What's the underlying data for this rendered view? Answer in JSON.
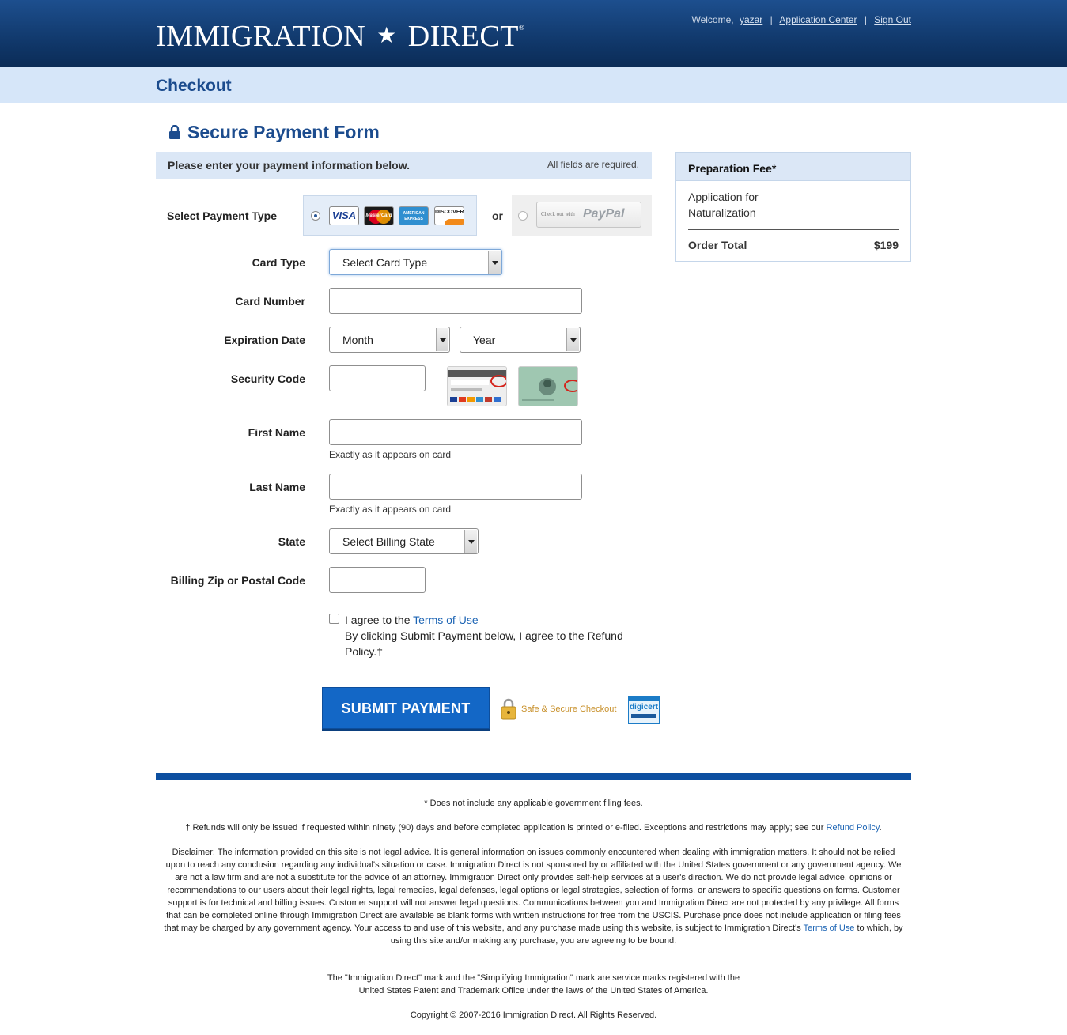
{
  "header": {
    "logo_left": "IMMIGRATION",
    "logo_star": "★",
    "logo_right": "DIRECT",
    "logo_reg": "®",
    "welcome": "Welcome,",
    "username": "yazar",
    "nav_sep": "|",
    "application_center": "Application Center",
    "sign_out": "Sign Out"
  },
  "page": {
    "title": "Checkout"
  },
  "form": {
    "heading": "Secure Payment Form",
    "intro": "Please enter your payment information below.",
    "required_note": "All fields are required.",
    "payment_type_label": "Select Payment Type",
    "cards": {
      "visa": "VISA",
      "mastercard": "MasterCard",
      "amex": "AMERICAN EXPRESS",
      "discover": "DISCOVER"
    },
    "or": "or",
    "paypal_small": "Check out with",
    "paypal_brand": "PayPal",
    "card_type_label": "Card Type",
    "card_type_value": "Select Card Type",
    "card_number_label": "Card Number",
    "expiration_label": "Expiration Date",
    "month_value": "Month",
    "year_value": "Year",
    "security_code_label": "Security Code",
    "first_name_label": "First Name",
    "first_name_hint": "Exactly as it appears on card",
    "last_name_label": "Last Name",
    "last_name_hint": "Exactly as it appears on card",
    "state_label": "State",
    "state_value": "Select Billing State",
    "zip_label": "Billing Zip or Postal Code",
    "agree_prefix": "I agree to the ",
    "terms_link": "Terms of Use",
    "agree_body": "By clicking Submit Payment below, I agree to the Refund Policy.†",
    "submit": "SUBMIT PAYMENT",
    "secure_checkout": "Safe & Secure Checkout"
  },
  "summary": {
    "heading": "Preparation Fee*",
    "item": "Application for Naturalization",
    "total_label": "Order Total",
    "total_value": "$199"
  },
  "footer": {
    "note1": "* Does not include any applicable government filing fees.",
    "refund_text": "† Refunds will only be issued if requested within ninety (90) days and before completed application is printed or e-filed. Exceptions and restrictions may apply; see our ",
    "refund_link": "Refund Policy",
    "refund_end": ".",
    "disclaimer": "Disclaimer: The information provided on this site is not legal advice. It is general information on issues commonly encountered when dealing with immigration matters. It should not be relied upon to reach any conclusion regarding any individual's situation or case. Immigration Direct is not sponsored by or affiliated with the United States government or any government agency. We are not a law firm and are not a substitute for the advice of an attorney. Immigration Direct only provides self-help services at a user's direction. We do not provide legal advice, opinions or recommendations to our users about their legal rights, legal remedies, legal defenses, legal options or legal strategies, selection of forms, or answers to specific questions on forms. Customer support is for technical and billing issues. Customer support will not answer legal questions. Communications between you and Immigration Direct are not protected by any privilege. All forms that can be completed online through Immigration Direct are available as blank forms with written instructions for free from the USCIS. Purchase price does not include application or filing fees that may be charged by any government agency. Your access to and use of this website, and any purchase made using this website, is subject to Immigration Direct's ",
    "disclaimer_link": "Terms of Use",
    "disclaimer_end": " to which, by using this site and/or making any purchase, you are agreeing to be bound.",
    "marks": "The \"Immigration Direct\" mark and the \"Simplifying Immigration\" mark are service marks registered with the United States Patent and Trademark Office under the laws of the United States of America.",
    "copyright": "Copyright © 2007-2016 Immigration Direct. All Rights Reserved."
  },
  "colors": {
    "header": "#0f3566",
    "accent": "#1c4c8e",
    "subbar": "#d6e6f9",
    "submit": "#1367c6",
    "link": "#1c64b4"
  },
  "icons": [
    "lock-icon",
    "padlock-icon",
    "digicert-seal-icon",
    "dropdown-arrow-icon"
  ]
}
